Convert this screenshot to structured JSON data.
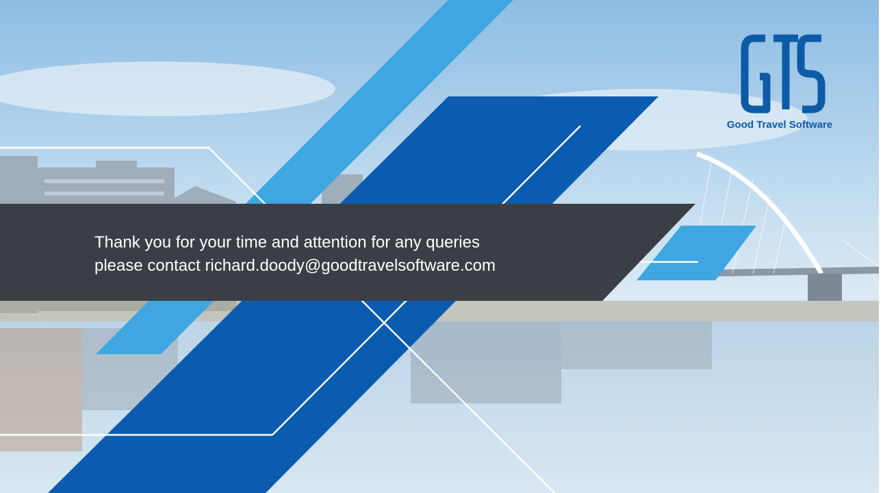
{
  "slide": {
    "message_lines": [
      "Thank you for your time and attention for any queries",
      "please contact richard.doody@goodtravelsoftware.com"
    ]
  },
  "logo": {
    "icon": "gts-monogram-logo",
    "text": "Good Travel Software",
    "color": "#0d5aa7"
  },
  "colors": {
    "band": "#3b3e44",
    "dark_blue": "#0b5cb0",
    "light_blue": "#3aa5e0",
    "sky_top": "#9ec6e6",
    "water": "#b9d5ea"
  }
}
